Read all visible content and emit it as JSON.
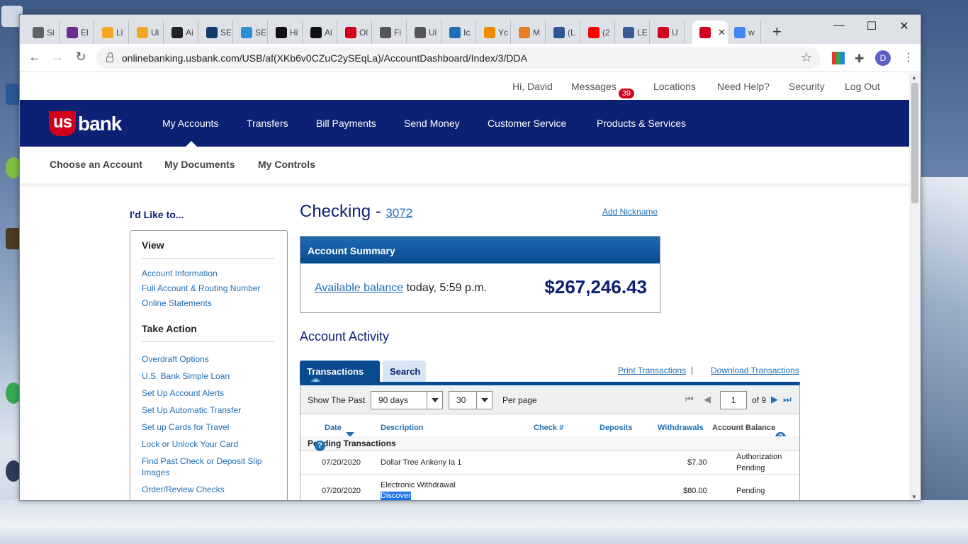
{
  "browser": {
    "tabs": [
      {
        "label": "Si",
        "icon": "globe-icon",
        "color": "#5f6368"
      },
      {
        "label": "El",
        "icon": "e-icon",
        "color": "#6a2c91"
      },
      {
        "label": "Li",
        "icon": "crown-icon",
        "color": "#f5a623"
      },
      {
        "label": "Ui",
        "icon": "crown-icon",
        "color": "#f5a623"
      },
      {
        "label": "Ai",
        "icon": "amazon-icon",
        "color": "#222222"
      },
      {
        "label": "SE",
        "icon": "sba-icon",
        "color": "#123a6b"
      },
      {
        "label": "SE",
        "icon": "m-icon",
        "color": "#2b8fd6"
      },
      {
        "label": "Hi",
        "icon": "f-icon",
        "color": "#111111"
      },
      {
        "label": "Ai",
        "icon": "aol-icon",
        "color": "#111111"
      },
      {
        "label": "Ol",
        "icon": "flag-icon",
        "color": "#d0021b"
      },
      {
        "label": "Fi",
        "icon": "wikipedia-icon",
        "color": "#555555"
      },
      {
        "label": "Ui",
        "icon": "wikipedia-icon",
        "color": "#555555"
      },
      {
        "label": "Ic",
        "icon": "globe-blue-icon",
        "color": "#1f6fb5"
      },
      {
        "label": "Yc",
        "icon": "square-icon",
        "color": "#f08c00"
      },
      {
        "label": "M",
        "icon": "rss-icon",
        "color": "#e67e22"
      },
      {
        "label": "(L",
        "icon": "w-icon",
        "color": "#2b5797"
      },
      {
        "label": "(2",
        "icon": "youtube-icon",
        "color": "#ff0000"
      },
      {
        "label": "LE",
        "icon": "image-icon",
        "color": "#3b5998"
      },
      {
        "label": "U",
        "icon": "usbank-icon",
        "color": "#d0021b"
      },
      {
        "label": "",
        "icon": "usbank-icon",
        "color": "#d0021b",
        "active": true
      },
      {
        "label": "w",
        "icon": "google-icon",
        "color": "#4285f4"
      }
    ],
    "close_tab_glyph": "✕",
    "new_tab_glyph": "+",
    "minimize_glyph": "—",
    "maximize_glyph": "☐",
    "close_glyph": "✕",
    "back_glyph": "←",
    "forward_glyph": "→",
    "reload_glyph": "↻",
    "url": "onlinebanking.usbank.com/USB/af(XKb6v0CZuC2ySEqLa)/AccountDashboard/Index/3/DDA",
    "star_glyph": "☆",
    "profile_initial": "D",
    "menu_glyph": "⋮"
  },
  "util_nav": {
    "greeting": "Hi, David",
    "messages": "Messages",
    "messages_count": "39",
    "locations": "Locations",
    "need_help": "Need Help?",
    "security": "Security",
    "logout": "Log Out"
  },
  "logo": {
    "us": "us",
    "bank": "bank"
  },
  "main_nav": [
    "My Accounts",
    "Transfers",
    "Bill Payments",
    "Send Money",
    "Customer Service",
    "Products & Services"
  ],
  "sub_nav": [
    "Choose an Account",
    "My Documents",
    "My Controls"
  ],
  "sidebar": {
    "title": "I'd Like to...",
    "view_heading": "View",
    "view_links": [
      "Account Information",
      "Full Account & Routing Number",
      "Online Statements"
    ],
    "action_heading": "Take Action",
    "action_links": [
      "Overdraft Options",
      "U.S. Bank Simple Loan",
      "Set Up Account Alerts",
      "Set Up Automatic Transfer",
      "Set up Cards for Travel",
      "Lock or Unlock Your Card",
      "Find Past Check or Deposit Slip Images",
      "Order/Review Checks"
    ]
  },
  "account": {
    "type": "Checking",
    "dash": " - ",
    "number": "3072",
    "add_nickname": "Add Nickname"
  },
  "summary": {
    "header": "Account Summary",
    "available_label": "Available balance",
    "as_of": " today, 5:59 p.m.",
    "balance": "$267,246.43"
  },
  "activity": {
    "heading": "Account Activity",
    "tab_transactions": "Transactions",
    "tab_search": "Search",
    "help_glyph": "?",
    "print": "Print Transactions",
    "separator": "|",
    "download": "Download Transactions",
    "show_the_past": "Show The Past",
    "period_value": "90 days",
    "per_page_value": "30",
    "per_page_label": "Per page",
    "page_value": "1",
    "page_of": "of 9",
    "first_glyph": "⏮",
    "prev_glyph": "◀",
    "next_glyph": "▶",
    "last_glyph": "⏭",
    "columns": {
      "date": "Date",
      "description": "Description",
      "check": "Check #",
      "deposits": "Deposits",
      "withdrawals": "Withdrawals",
      "balance": "Account Balance"
    },
    "pending_label": "Pending Transactions",
    "rows": [
      {
        "date": "07/20/2020",
        "description": "Dollar Tree Ankeny Ia 1",
        "description2": "",
        "withdrawal": "$7.30",
        "status": "Authorization",
        "status2": "Pending"
      },
      {
        "date": "07/20/2020",
        "description": "Electronic Withdrawal",
        "description2": "Discover",
        "withdrawal": "$80.00",
        "status": "Pending",
        "status2": ""
      }
    ]
  }
}
